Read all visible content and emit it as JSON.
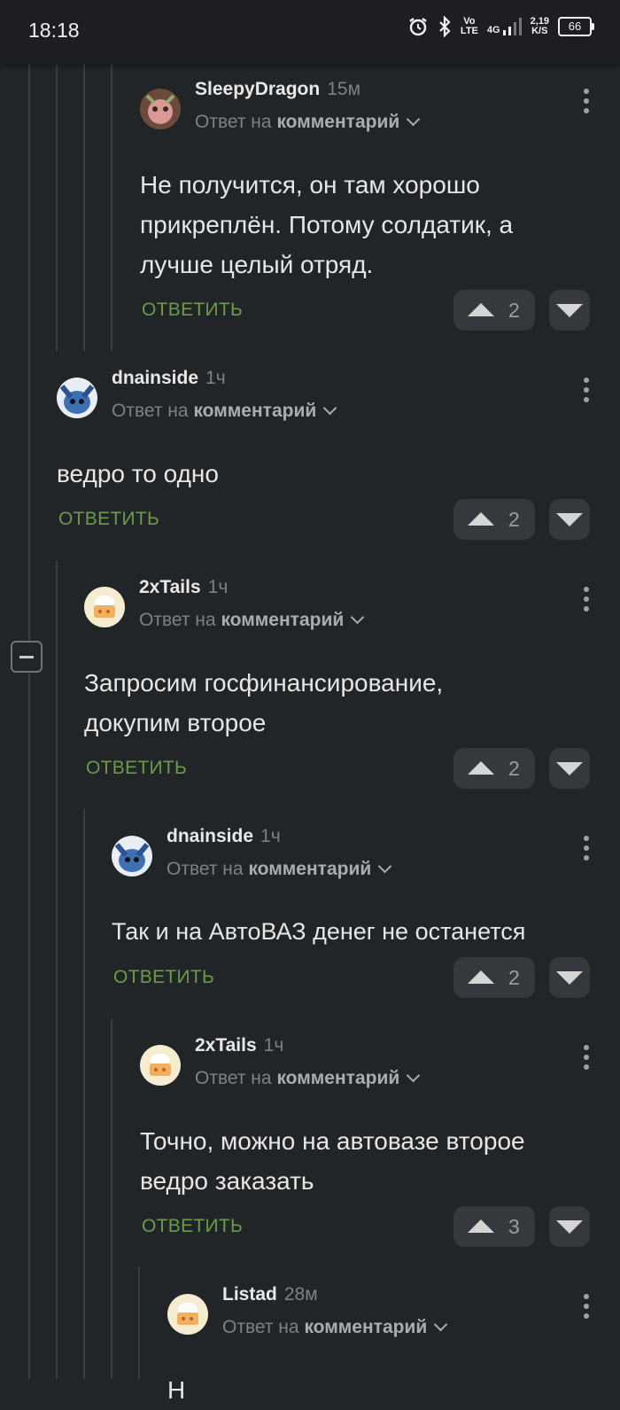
{
  "status_bar": {
    "time": "18:18",
    "network_top": "Vo",
    "network_bottom": "LTE",
    "network_type": "4G",
    "speed_value": "2,19",
    "speed_unit": "K/S",
    "battery": "66"
  },
  "labels": {
    "reply_to_prefix": "Ответ на",
    "reply_to_target": "комментарий",
    "reply_button": "ОТВЕТИТЬ"
  },
  "comments": [
    {
      "username": "SleepyDragon",
      "time": "15м",
      "text": "Не получится, он там хорошо\nприкреплён. Потому солдатик, а\nлучше целый отряд.",
      "votes": "2"
    },
    {
      "username": "dnainside",
      "time": "1ч",
      "text": "ведро то одно",
      "votes": "2"
    },
    {
      "username": "2xTails",
      "time": "1ч",
      "text": "Запросим госфинансирование,\nдокупим второе",
      "votes": "2"
    },
    {
      "username": "dnainside",
      "time": "1ч",
      "text": "Так и на АвтоВАЗ денег не останется",
      "votes": "2"
    },
    {
      "username": "2xTails",
      "time": "1ч",
      "text": "Точно, можно на автовазе второе\nведро заказать",
      "votes": "3"
    },
    {
      "username": "Listad",
      "time": "28м",
      "text": "Н",
      "votes": ""
    }
  ]
}
